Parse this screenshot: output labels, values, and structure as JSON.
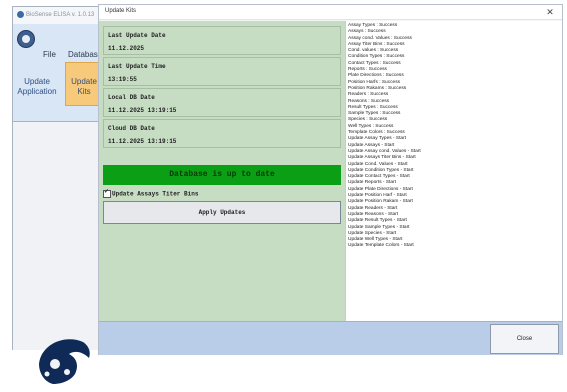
{
  "background_app": {
    "title": "BioSense ELISA v. 1.0.13",
    "menu": {
      "file": "File",
      "database": "Databas"
    },
    "buttons": {
      "update_application": "Update Application",
      "update_kits": "Update Kits"
    }
  },
  "dialog": {
    "title": "Update Kits",
    "close_glyph": "✕",
    "info": [
      {
        "label": "Last Update Date",
        "value": "11.12.2025"
      },
      {
        "label": "Last Update Time",
        "value": "13:19:55"
      },
      {
        "label": "Local DB Date",
        "value": "11.12.2025 13:19:15"
      },
      {
        "label": "Cloud DB Date",
        "value": "11.12.2025 13:19:15"
      }
    ],
    "db_status": "Database is up to date",
    "checkbox_label": "Update Assays Titer Bins",
    "checkbox_checked": true,
    "apply_button": "Apply Updates",
    "close_button": "Close",
    "log": [
      "Assay Types : Success",
      "Assays : Success",
      "Assay cond. Values : Success",
      "Assay Titer Bins : Success",
      "Cond. values : Success",
      "Condition Types : Success",
      "Contact Types : Success",
      "Reports : Success",
      "Plate Directions : Success",
      "Position Harfs : Success",
      "Position Rakams : Success",
      "Readers : Success",
      "Reasons : Success",
      "Result Types : Success",
      "Sample Types : Success",
      "Species : Success",
      "Well Types : Success",
      "Template Colors : Success",
      "Update Assay Types - Start",
      "Update Assays - Start",
      "Update Assay cond. Values - Start",
      "Update Assays Titer Bins - Start",
      "Update Cond. Values - Start",
      "Update Condition Types - Start",
      "Update Contact Types - Start",
      "Update Reports - Start",
      "Update Plate Directions - Start",
      "Update Position Harf - Start",
      "Update Position Rakam - Start",
      "Update Readers - Start",
      "Update Reasons - Start",
      "Update Result Types - Start",
      "Update Sample Types - Start",
      "Update Species - Start",
      "Update Well Types - Start",
      "Update Template Colors - Start"
    ]
  },
  "colors": {
    "panel_green": "#c6dcc3",
    "status_green": "#0b9f16",
    "bottom_bar": "#b9cde8",
    "ribbon_blue": "#d9e6f6",
    "active_tab_orange": "#f7c97a"
  }
}
